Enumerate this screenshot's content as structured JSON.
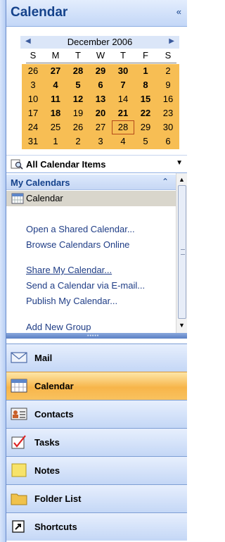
{
  "header": {
    "title": "Calendar",
    "collapse_glyph": "«"
  },
  "calendar": {
    "month_label": "December 2006",
    "prev_glyph": "◀",
    "next_glyph": "▶",
    "weekdays": [
      "S",
      "M",
      "T",
      "W",
      "T",
      "F",
      "S"
    ],
    "days": [
      {
        "n": "26",
        "b": false
      },
      {
        "n": "27",
        "b": true
      },
      {
        "n": "28",
        "b": true
      },
      {
        "n": "29",
        "b": true
      },
      {
        "n": "30",
        "b": true
      },
      {
        "n": "1",
        "b": true
      },
      {
        "n": "2",
        "b": false
      },
      {
        "n": "3",
        "b": false
      },
      {
        "n": "4",
        "b": true
      },
      {
        "n": "5",
        "b": true
      },
      {
        "n": "6",
        "b": true
      },
      {
        "n": "7",
        "b": true
      },
      {
        "n": "8",
        "b": true
      },
      {
        "n": "9",
        "b": false
      },
      {
        "n": "10",
        "b": false
      },
      {
        "n": "11",
        "b": true
      },
      {
        "n": "12",
        "b": true
      },
      {
        "n": "13",
        "b": true
      },
      {
        "n": "14",
        "b": false
      },
      {
        "n": "15",
        "b": true
      },
      {
        "n": "16",
        "b": false
      },
      {
        "n": "17",
        "b": false
      },
      {
        "n": "18",
        "b": true
      },
      {
        "n": "19",
        "b": false
      },
      {
        "n": "20",
        "b": true
      },
      {
        "n": "21",
        "b": true
      },
      {
        "n": "22",
        "b": true
      },
      {
        "n": "23",
        "b": false
      },
      {
        "n": "24",
        "b": false
      },
      {
        "n": "25",
        "b": false
      },
      {
        "n": "26",
        "b": false
      },
      {
        "n": "27",
        "b": false
      },
      {
        "n": "28",
        "b": false,
        "today": true
      },
      {
        "n": "29",
        "b": false
      },
      {
        "n": "30",
        "b": false
      },
      {
        "n": "31",
        "b": false
      },
      {
        "n": "1",
        "b": false
      },
      {
        "n": "2",
        "b": false
      },
      {
        "n": "3",
        "b": false
      },
      {
        "n": "4",
        "b": false
      },
      {
        "n": "5",
        "b": false
      },
      {
        "n": "6",
        "b": false
      }
    ]
  },
  "all_items": {
    "label": "All Calendar Items",
    "icon": "search-icon",
    "dropdown_glyph": "▼"
  },
  "my_calendars": {
    "label": "My Calendars",
    "chevron_glyph": "⌃",
    "items": [
      {
        "label": "Calendar",
        "icon": "calendar-icon"
      }
    ]
  },
  "links": [
    {
      "label": "Open a Shared Calendar...",
      "underline": false
    },
    {
      "label": "Browse Calendars Online",
      "underline": false
    },
    {
      "label": "Share My Calendar...",
      "underline": true
    },
    {
      "label": "Send a Calendar via E-mail...",
      "underline": false
    },
    {
      "label": "Publish My Calendar...",
      "underline": false
    },
    {
      "label": "Add New Group",
      "underline": false
    }
  ],
  "scrollbar": {
    "up_glyph": "▲",
    "down_glyph": "▼"
  },
  "nav_buttons": [
    {
      "label": "Mail",
      "icon": "mail-icon",
      "active": false
    },
    {
      "label": "Calendar",
      "icon": "calendar-icon",
      "active": true
    },
    {
      "label": "Contacts",
      "icon": "contacts-icon",
      "active": false
    },
    {
      "label": "Tasks",
      "icon": "tasks-icon",
      "active": false
    },
    {
      "label": "Notes",
      "icon": "notes-icon",
      "active": false
    },
    {
      "label": "Folder List",
      "icon": "folder-icon",
      "active": false
    },
    {
      "label": "Shortcuts",
      "icon": "shortcut-icon",
      "active": false
    }
  ],
  "colors": {
    "month_highlight": "#f7be54",
    "active_tab": "#f7b54a",
    "link": "#1f3d86",
    "title": "#15428b"
  }
}
